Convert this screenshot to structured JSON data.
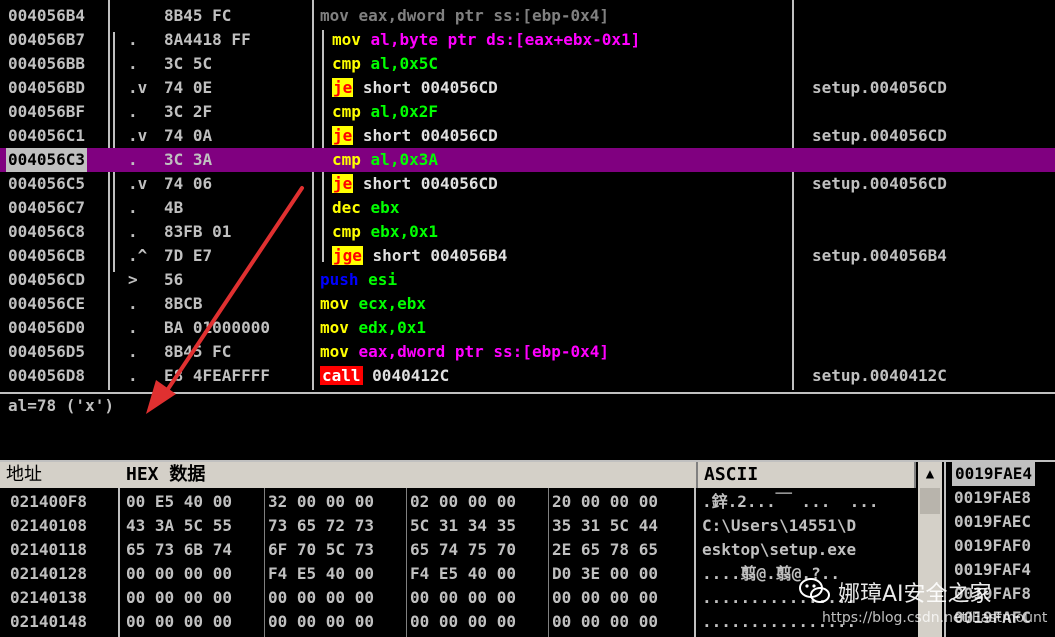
{
  "disasm": {
    "rows": [
      {
        "addr": "004056B4",
        "mark": "",
        "hex": "8B45 FC",
        "mnem": "mov",
        "ops": "eax,dword ptr ss:[ebp-0x4]",
        "comment": "",
        "sel": false
      },
      {
        "addr": "004056B7",
        "mark": ".",
        "hex": "8A4418 FF",
        "mnem": "mov",
        "ops": "al,byte ptr ds:[eax+ebx-0x1]",
        "comment": "",
        "sel": false
      },
      {
        "addr": "004056BB",
        "mark": ".",
        "hex": "3C 5C",
        "mnem": "cmp",
        "ops": "al,0x5C",
        "comment": "",
        "sel": false
      },
      {
        "addr": "004056BD",
        "mark": ".v",
        "hex": "74 0E",
        "mnem": "je",
        "ops": "short 004056CD",
        "comment": "setup.004056CD",
        "sel": false
      },
      {
        "addr": "004056BF",
        "mark": ".",
        "hex": "3C 2F",
        "mnem": "cmp",
        "ops": "al,0x2F",
        "comment": "",
        "sel": false
      },
      {
        "addr": "004056C1",
        "mark": ".v",
        "hex": "74 0A",
        "mnem": "je",
        "ops": "short 004056CD",
        "comment": "setup.004056CD",
        "sel": false
      },
      {
        "addr": "004056C3",
        "mark": ".",
        "hex": "3C 3A",
        "mnem": "cmp",
        "ops": "al,0x3A",
        "comment": "",
        "sel": true
      },
      {
        "addr": "004056C5",
        "mark": ".v",
        "hex": "74 06",
        "mnem": "je",
        "ops": "short 004056CD",
        "comment": "setup.004056CD",
        "sel": false
      },
      {
        "addr": "004056C7",
        "mark": ".",
        "hex": "4B",
        "mnem": "dec",
        "ops": "ebx",
        "comment": "",
        "sel": false
      },
      {
        "addr": "004056C8",
        "mark": ".",
        "hex": "83FB 01",
        "mnem": "cmp",
        "ops": "ebx,0x1",
        "comment": "",
        "sel": false
      },
      {
        "addr": "004056CB",
        "mark": ".^",
        "hex": "7D E7",
        "mnem": "jge",
        "ops": "short 004056B4",
        "comment": "setup.004056B4",
        "sel": false
      },
      {
        "addr": "004056CD",
        "mark": ">",
        "hex": "56",
        "mnem": "push",
        "ops": "esi",
        "comment": "",
        "sel": false
      },
      {
        "addr": "004056CE",
        "mark": ".",
        "hex": "8BCB",
        "mnem": "mov",
        "ops": "ecx,ebx",
        "comment": "",
        "sel": false
      },
      {
        "addr": "004056D0",
        "mark": ".",
        "hex": "BA 01000000",
        "mnem": "mov",
        "ops": "edx,0x1",
        "comment": "",
        "sel": false
      },
      {
        "addr": "004056D5",
        "mark": ".",
        "hex": "8B45 FC",
        "mnem": "mov",
        "ops": "eax,dword ptr ss:[ebp-0x4]",
        "comment": "",
        "sel": false
      },
      {
        "addr": "004056D8",
        "mark": ".",
        "hex": "E8 4FEAFFFF",
        "mnem": "call",
        "ops": "0040412C",
        "comment": "setup.0040412C",
        "sel": false
      }
    ]
  },
  "info": {
    "text": "al=78 ('x')"
  },
  "dump": {
    "headers": {
      "addr": "地址",
      "hex": "HEX 数据",
      "ascii": "ASCII"
    },
    "rows": [
      {
        "addr": "021400F8",
        "hex": [
          "00 E5 40 00",
          "32 00 00 00",
          "02 00 00 00",
          "20 00 00 00"
        ],
        "ascii": ".鋅.2...￣ ...  ..."
      },
      {
        "addr": "02140108",
        "hex": [
          "43 3A 5C 55",
          "73 65 72 73",
          "5C 31 34 35",
          "35 31 5C 44"
        ],
        "ascii": "C:\\Users\\14551\\D"
      },
      {
        "addr": "02140118",
        "hex": [
          "65 73 6B 74",
          "6F 70 5C 73",
          "65 74 75 70",
          "2E 65 78 65"
        ],
        "ascii": "esktop\\setup.exe"
      },
      {
        "addr": "02140128",
        "hex": [
          "00 00 00 00",
          "F4 E5 40 00",
          "F4 E5 40 00",
          "D0 3E 00 00"
        ],
        "ascii": "....翦@.翦@.?.."
      },
      {
        "addr": "02140138",
        "hex": [
          "00 00 00 00",
          "00 00 00 00",
          "00 00 00 00",
          "00 00 00 00"
        ],
        "ascii": "................"
      },
      {
        "addr": "02140148",
        "hex": [
          "00 00 00 00",
          "00 00 00 00",
          "00 00 00 00",
          "00 00 00 00"
        ],
        "ascii": "................"
      }
    ]
  },
  "stack": {
    "rows": [
      "0019FAE4",
      "0019FAE8",
      "0019FAEC",
      "0019FAF0",
      "0019FAF4",
      "0019FAF8",
      "0019FAFC"
    ]
  },
  "scroll": {
    "up_arrow": "▲"
  },
  "watermark": {
    "text": "娜璋AI安全之家",
    "url": "https://blog.csdn.net/Eastmount"
  },
  "colors": {
    "selection": "#800080",
    "jump_bg": "#ffff00",
    "call_bg": "#ff0000",
    "arrow": "#e03030"
  }
}
